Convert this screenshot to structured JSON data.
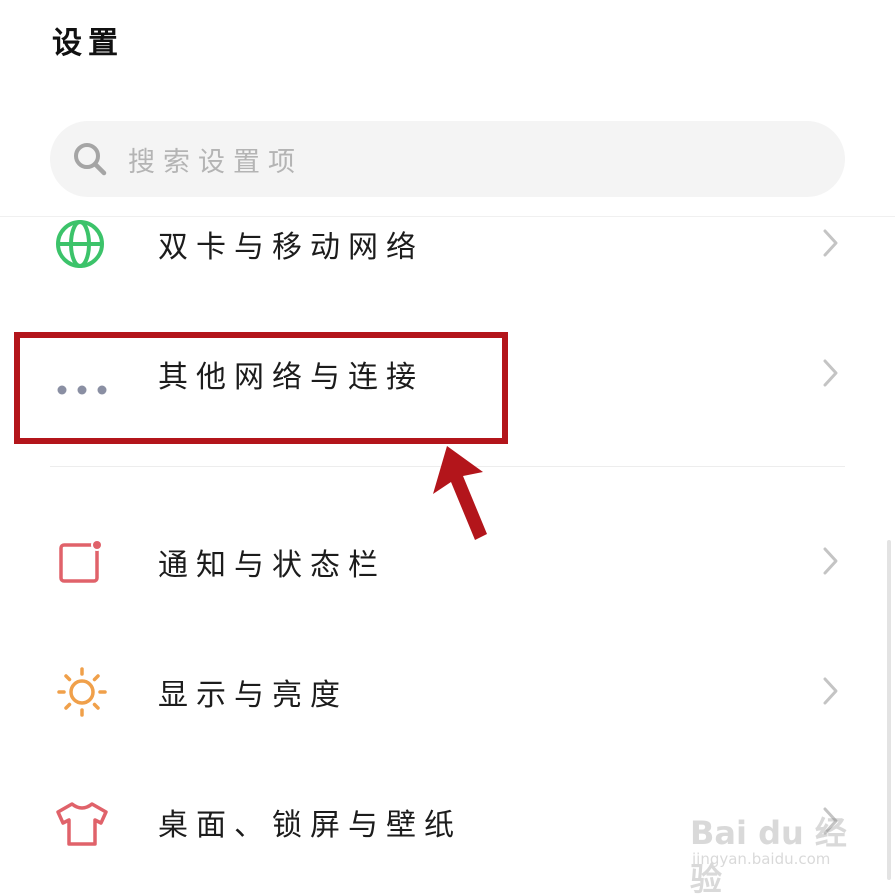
{
  "header": {
    "title": "设置"
  },
  "search": {
    "placeholder": "搜索设置项"
  },
  "items": [
    {
      "label": "双卡与移动网络",
      "icon": "globe-icon",
      "color": "#3cc36a"
    },
    {
      "label": "其他网络与连接",
      "icon": "more-dots-icon",
      "color": "#8a8fa3"
    },
    {
      "label": "通知与状态栏",
      "icon": "notification-square-icon",
      "color": "#e0626a"
    },
    {
      "label": "显示与亮度",
      "icon": "sun-icon",
      "color": "#f0a04a"
    },
    {
      "label": "桌面、锁屏与壁纸",
      "icon": "tshirt-icon",
      "color": "#e0626a"
    }
  ],
  "annotation": {
    "highlight_color": "#b3151b",
    "highlighted_item": "其他网络与连接"
  },
  "watermark": {
    "logo_text": "Bai du 经验",
    "sub_text": "jingyan.baidu.com"
  }
}
